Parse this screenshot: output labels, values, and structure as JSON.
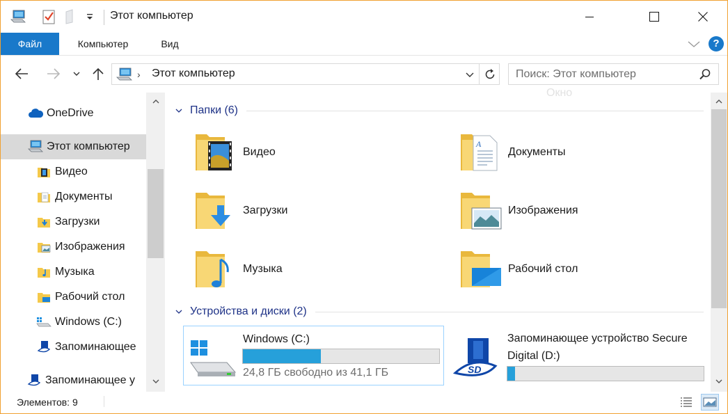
{
  "window": {
    "title": "Этот компьютер"
  },
  "ribbon": {
    "tabs": [
      "Файл",
      "Компьютер",
      "Вид"
    ],
    "help": "?"
  },
  "address": {
    "path": "Этот компьютер",
    "search_placeholder": "Поиск: Этот компьютер",
    "ghost_text": "Окно"
  },
  "nav": {
    "items": [
      {
        "label": "OneDrive",
        "icon": "cloud-icon"
      },
      {
        "label": "Этот компьютер",
        "icon": "computer-icon",
        "selected": true
      },
      {
        "label": "Видео",
        "icon": "video-folder-icon"
      },
      {
        "label": "Документы",
        "icon": "documents-folder-icon"
      },
      {
        "label": "Загрузки",
        "icon": "downloads-folder-icon"
      },
      {
        "label": "Изображения",
        "icon": "pictures-folder-icon"
      },
      {
        "label": "Музыка",
        "icon": "music-folder-icon"
      },
      {
        "label": "Рабочий стол",
        "icon": "desktop-folder-icon"
      },
      {
        "label": "Windows (C:)",
        "icon": "drive-icon"
      },
      {
        "label": "Запоминающее",
        "icon": "sd-card-icon"
      },
      {
        "label": "Запоминающее у",
        "icon": "sd-card-icon"
      }
    ]
  },
  "content": {
    "folders_group": "Папки (6)",
    "folders": [
      {
        "name": "Видео",
        "icon": "video-folder-icon"
      },
      {
        "name": "Документы",
        "icon": "documents-folder-icon"
      },
      {
        "name": "Загрузки",
        "icon": "downloads-folder-icon"
      },
      {
        "name": "Изображения",
        "icon": "pictures-folder-icon"
      },
      {
        "name": "Музыка",
        "icon": "music-folder-icon"
      },
      {
        "name": "Рабочий стол",
        "icon": "desktop-folder-icon"
      }
    ],
    "drives_group": "Устройства и диски (2)",
    "drives": [
      {
        "name": "Windows (C:)",
        "free_text": "24,8 ГБ свободно из 41,1 ГБ",
        "used_fraction": 0.397,
        "icon": "drive-icon"
      },
      {
        "name": "Запоминающее устройство Secure Digital (D:)",
        "used_fraction": 0.04,
        "icon": "sd-card-icon"
      }
    ]
  },
  "status": {
    "items_text": "Элементов: 9"
  },
  "colors": {
    "accent": "#1979ca",
    "bar_fill": "#26a0da",
    "group_header": "#1e3287",
    "selection": "#d9d9d9"
  }
}
